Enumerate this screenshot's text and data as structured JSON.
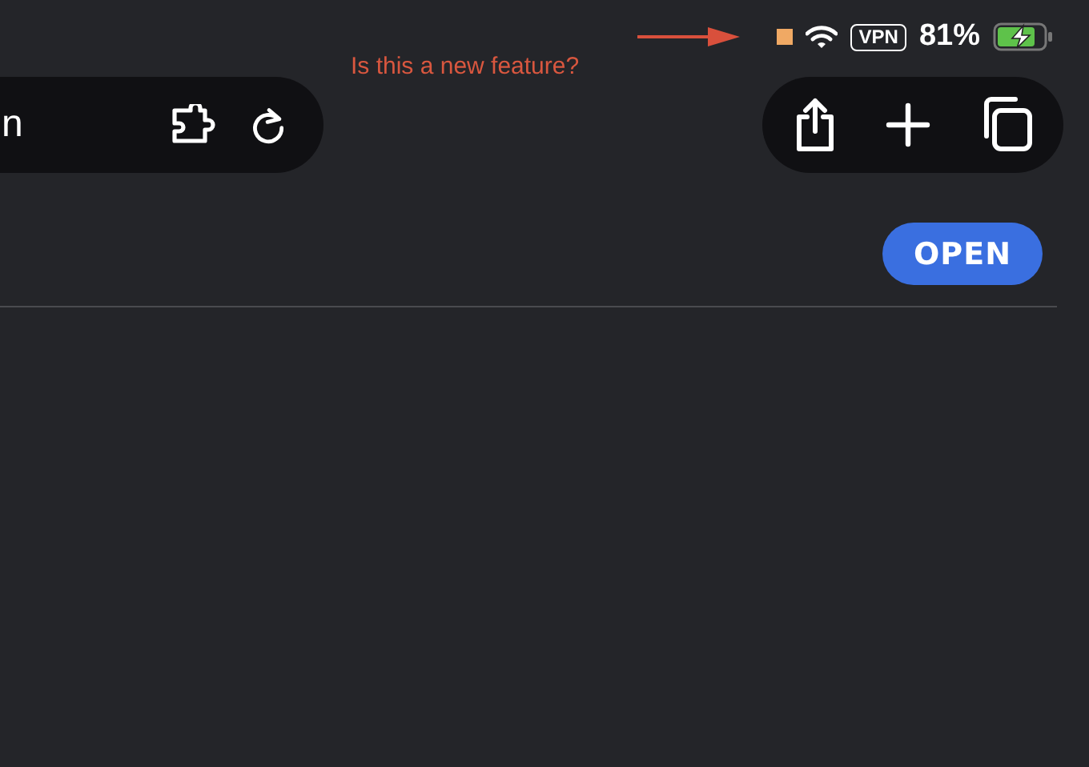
{
  "status_bar": {
    "vpn": "VPN",
    "battery": "81%",
    "charging": true
  },
  "annotation": {
    "text": "Is this a new feature?"
  },
  "address_bar": {
    "text": "n"
  },
  "open_button": {
    "label": "OPEN"
  }
}
